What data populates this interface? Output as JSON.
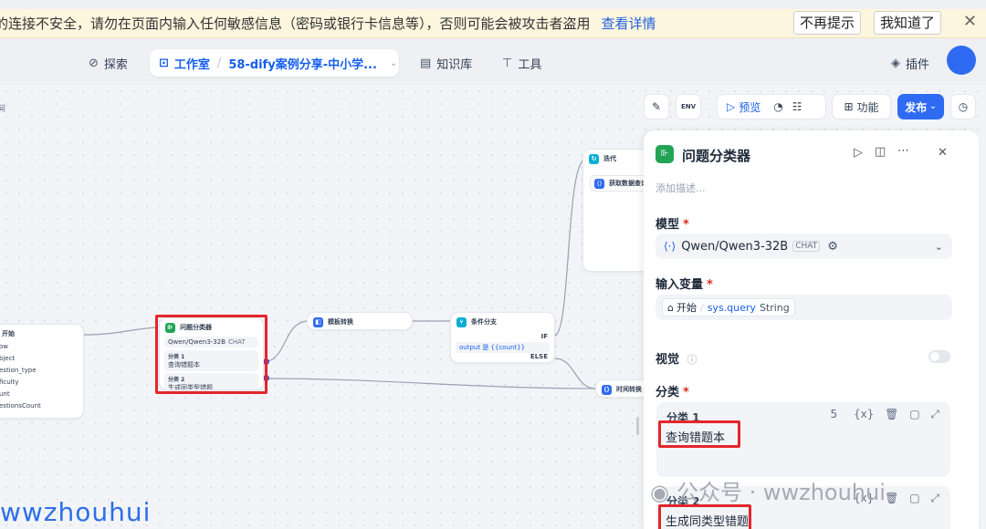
{
  "banner": {
    "message": "的连接不安全，请勿在页面内输入任何敏感信息（密码或银行卡信息等），否则可能会被攻击者盗用",
    "details_link": "查看详情",
    "dont_show": "不再提示",
    "got_it": "我知道了",
    "close": "✕"
  },
  "nav": {
    "explore": "探索",
    "studio": "工作室",
    "app_name": "58-dify案例分享-中小学...",
    "knowledge": "知识库",
    "tools": "工具",
    "plugins": "插件"
  },
  "toolbar": {
    "preview": "预览",
    "features": "功能",
    "publish": "发布",
    "env": "ENV"
  },
  "canvas": {
    "left_edge_label": "间",
    "start_node": {
      "title": "开始",
      "rows": [
        "ow",
        "bject",
        "estion_type",
        "ficulty",
        "unt",
        "estionsCount"
      ]
    },
    "classifier_node": {
      "title": "问题分类器",
      "model": "Qwen/Qwen3-32B",
      "model_tag": "CHAT",
      "class1_label": "分类 1",
      "class1_text": "查询错题本",
      "class2_label": "分类 2",
      "class2_text": "生成同类型错题"
    },
    "template_node": {
      "title": "模板转换"
    },
    "if_node": {
      "title": "条件分支",
      "if_label": "IF",
      "condition": "output 是 {{count}}",
      "else_label": "ELSE"
    },
    "iter_node": {
      "title": "迭代",
      "child": "获取数据查询"
    },
    "time_node": {
      "title": "时间转换"
    }
  },
  "panel": {
    "title": "问题分类器",
    "desc_placeholder": "添加描述...",
    "model_label": "模型",
    "model_name": "Qwen/Qwen3-32B",
    "model_tag": "CHAT",
    "input_label": "输入变量",
    "input_start": "开始",
    "input_var": "sys.query",
    "input_type": "String",
    "vision_label": "视觉",
    "class_label": "分类",
    "class1_name": "分类 1",
    "class1_count": "5",
    "class1_text": "查询错题本",
    "class2_name": "分类 2",
    "class2_text": "生成同类型错题"
  },
  "watermark": {
    "wechat": "公众号 · wwzhouhui",
    "handle": "wwzhouhui"
  },
  "colors": {
    "accent": "#155eef",
    "publish": "#2f6bf2",
    "highlight": "#e3262b",
    "classifier_badge": "#22a454"
  }
}
